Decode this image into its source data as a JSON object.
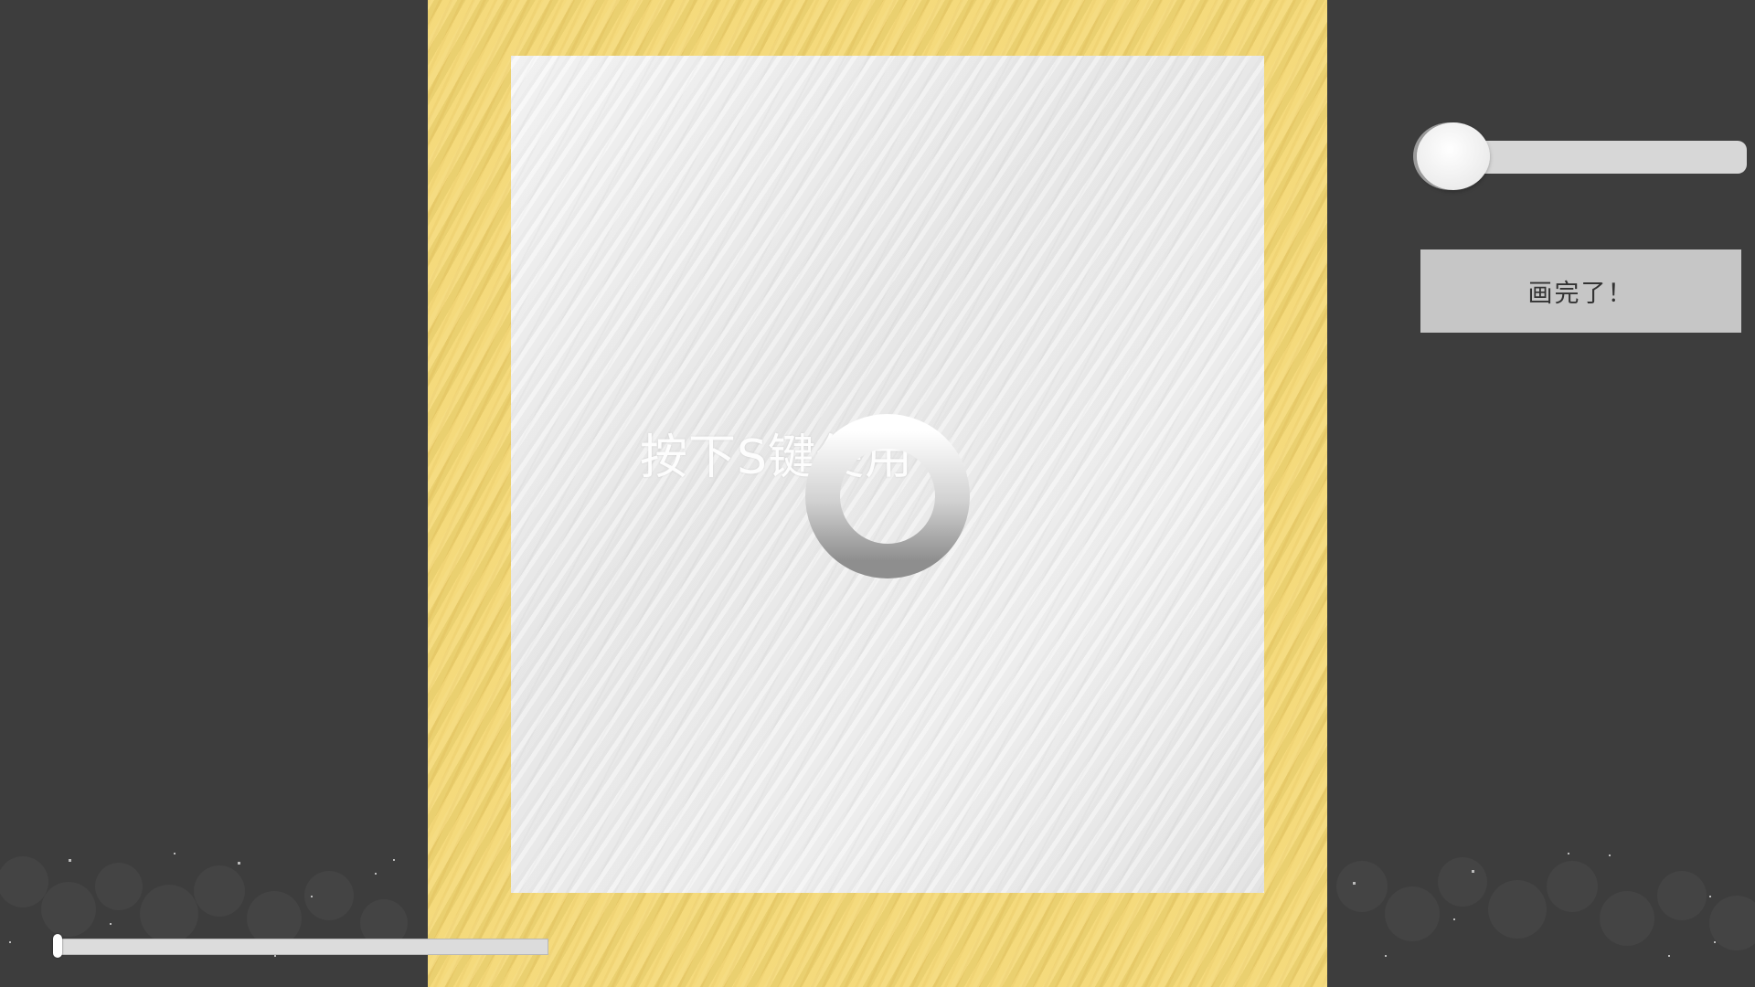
{
  "canvas": {
    "hint": "按下S键使用",
    "frame_color": "#f4d874",
    "paper_color": "#f0f0f0",
    "ring_icon": "loading-ring-icon"
  },
  "brush_size_slider": {
    "value": 0.0
  },
  "done_button": {
    "label": "画完了！"
  },
  "progress_slider": {
    "value": 0.0
  },
  "colors": {
    "background": "#3d3d3d",
    "button": "#c6c6c6",
    "slider_track": "#d7d7d7"
  }
}
